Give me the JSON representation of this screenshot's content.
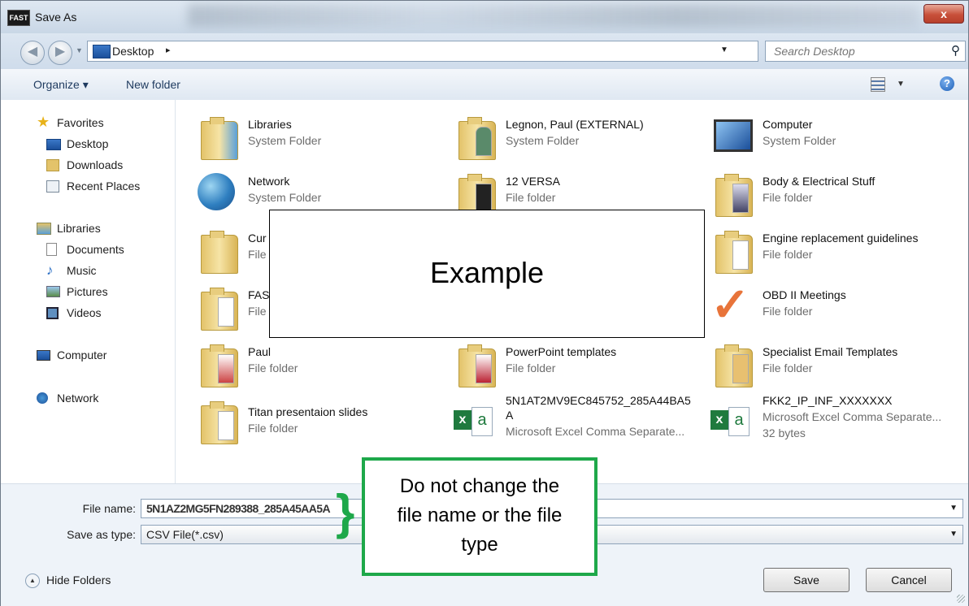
{
  "window": {
    "title": "Save As",
    "app_badge": "FAST",
    "close_glyph": "x"
  },
  "address": {
    "crumb": "Desktop",
    "crumb_arrow": "▸",
    "search_placeholder": "Search Desktop"
  },
  "toolbar": {
    "organize": "Organize ▾",
    "new_folder": "New folder"
  },
  "nav": {
    "favorites": "Favorites",
    "desktop": "Desktop",
    "downloads": "Downloads",
    "recent": "Recent Places",
    "libraries": "Libraries",
    "documents": "Documents",
    "music": "Music",
    "pictures": "Pictures",
    "videos": "Videos",
    "computer": "Computer",
    "network": "Network"
  },
  "files": [
    {
      "name": "Libraries",
      "type": "System Folder"
    },
    {
      "name": "Legnon, Paul (EXTERNAL)",
      "type": "System Folder"
    },
    {
      "name": "Computer",
      "type": "System Folder"
    },
    {
      "name": "Network",
      "type": "System Folder"
    },
    {
      "name": "12 VERSA",
      "type": "File folder"
    },
    {
      "name": "Body & Electrical Stuff",
      "type": "File folder"
    },
    {
      "name": "Cur",
      "type": "File"
    },
    {
      "name": "Engine replacement guidelines",
      "type": "File folder"
    },
    {
      "name": "FAS",
      "type": "File"
    },
    {
      "name": "OBD II Meetings",
      "type": "File folder"
    },
    {
      "name": "Paul",
      "type": "File folder"
    },
    {
      "name": "PowerPoint templates",
      "type": "File folder"
    },
    {
      "name": "Specialist Email Templates",
      "type": "File folder"
    },
    {
      "name": "Titan presentaion slides",
      "type": "File folder"
    },
    {
      "name": "5N1AT2MV9EC845752_285A44BA5",
      "name2": "A",
      "type": "Microsoft Excel Comma Separate..."
    },
    {
      "name": "FKK2_IP_INF_XXXXXXX",
      "type": "Microsoft Excel Comma Separate...",
      "size": "32 bytes"
    }
  ],
  "overlay": {
    "text": "Example"
  },
  "form": {
    "file_name_label": "File name:",
    "file_name_value": "5N1AZ2MG5FN289388_285A45AA5A",
    "save_type_label": "Save as type:",
    "save_type_value": "CSV File(*.csv)"
  },
  "footer": {
    "hide_folders": "Hide Folders",
    "save": "Save",
    "cancel": "Cancel"
  },
  "callout": {
    "line1": "Do not change the",
    "line2": "file name or the file",
    "line3": "type"
  }
}
